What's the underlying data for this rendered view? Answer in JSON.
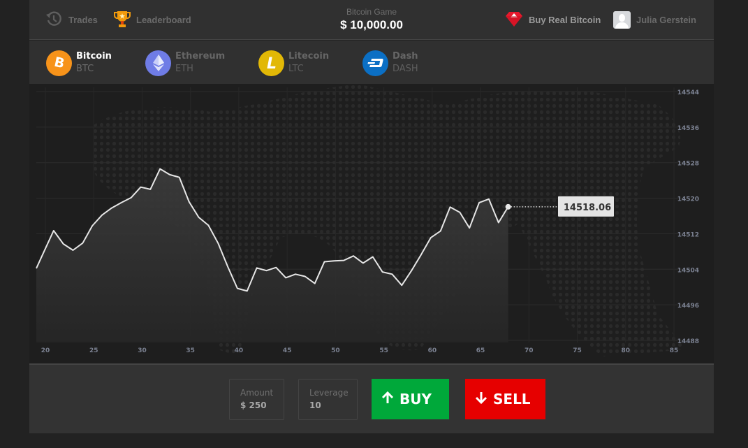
{
  "header": {
    "trades_label": "Trades",
    "leaderboard_label": "Leaderboard",
    "balance_label": "Bitcoin Game",
    "balance_value": "$ 10,000.00",
    "buy_real_label": "Buy Real Bitcoin",
    "user_name": "Julia Gerstein"
  },
  "coins": [
    {
      "name": "Bitcoin",
      "symbol": "BTC",
      "color": "#f7931a",
      "glyph": "₿",
      "active": true
    },
    {
      "name": "Ethereum",
      "symbol": "ETH",
      "color": "#6f7ce6",
      "glyph": "◆",
      "active": false
    },
    {
      "name": "Litecoin",
      "symbol": "LTC",
      "color": "#e2b806",
      "glyph": "Ł",
      "active": false
    },
    {
      "name": "Dash",
      "symbol": "DASH",
      "color": "#0b6fc4",
      "glyph": "D",
      "active": false
    }
  ],
  "trade": {
    "amount_label": "Amount",
    "amount_value": "$ 250",
    "leverage_label": "Leverage",
    "leverage_value": "10",
    "buy_label": "BUY",
    "sell_label": "SELL",
    "buy_color": "#00a83a",
    "sell_color": "#e60000"
  },
  "chart_data": {
    "type": "area",
    "title": "",
    "xlabel": "",
    "ylabel": "",
    "current_value_label": "14518.06",
    "x_ticks": [
      20,
      25,
      30,
      35,
      40,
      45,
      50,
      55,
      60,
      65,
      70,
      75,
      80,
      85
    ],
    "y_ticks": [
      14488,
      14496,
      14504,
      14512,
      14520,
      14528,
      14536,
      14544
    ],
    "xlim": [
      19,
      85
    ],
    "ylim": [
      14488,
      14544
    ],
    "grid": true,
    "x": [
      19,
      20,
      21,
      22,
      23,
      24,
      25,
      26,
      27,
      28,
      29,
      30,
      31,
      32,
      33,
      34,
      35,
      36,
      37,
      38,
      39,
      40,
      41,
      42,
      43,
      44,
      45,
      46,
      47,
      48,
      49,
      50,
      51,
      52,
      53,
      54,
      55,
      56,
      57,
      58,
      59,
      60,
      61,
      62,
      63,
      64,
      65,
      66,
      67,
      68
    ],
    "values": [
      14504.2,
      14508.0,
      14512.7,
      14509.7,
      14508.3,
      14509.9,
      14513.8,
      14516.2,
      14517.8,
      14519.0,
      14520.1,
      14522.5,
      14522.0,
      14526.6,
      14525.3,
      14524.7,
      14519.2,
      14515.7,
      14513.9,
      14509.9,
      14504.6,
      14499.7,
      14499.1,
      14504.3,
      14503.7,
      14504.4,
      14502.1,
      14502.9,
      14502.4,
      14500.8,
      14505.7,
      14505.9,
      14506.0,
      14507.0,
      14505.4,
      14506.8,
      14503.4,
      14502.9,
      14500.4,
      14503.7,
      14507.3,
      14511.1,
      14512.6,
      14518.0,
      14516.8,
      14513.3,
      14519.0,
      14519.8,
      14514.5,
      14518.06
    ]
  }
}
